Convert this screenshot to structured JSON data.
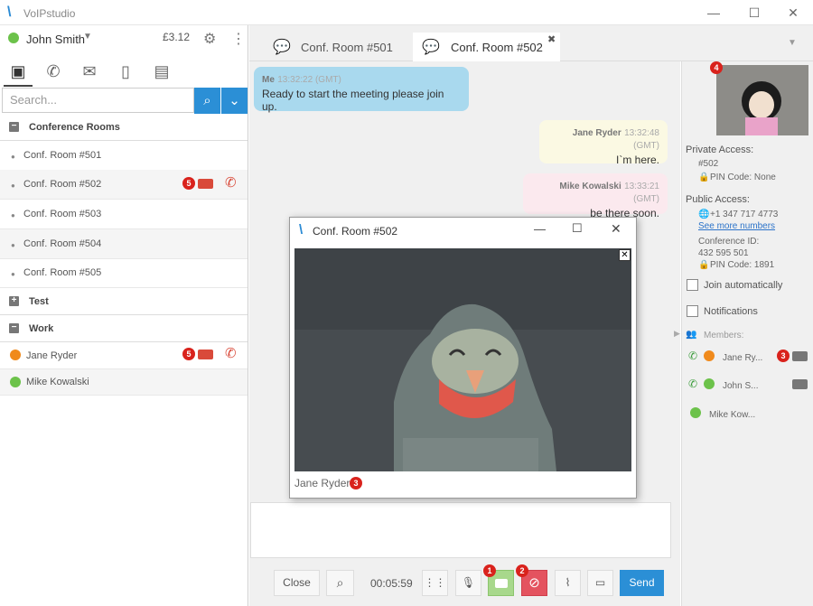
{
  "app": {
    "title": "VoIPstudio"
  },
  "user": {
    "name": "John Smith",
    "balance": "£3.12"
  },
  "search": {
    "placeholder": "Search..."
  },
  "sidebar": {
    "groups": [
      {
        "label": "Conference Rooms"
      },
      {
        "label": "Test"
      },
      {
        "label": "Work"
      }
    ],
    "rooms": [
      {
        "label": "Conf. Room #501"
      },
      {
        "label": "Conf. Room #502"
      },
      {
        "label": "Conf. Room #503"
      },
      {
        "label": "Conf. Room #504"
      },
      {
        "label": "Conf. Room #505"
      }
    ],
    "contacts": [
      {
        "label": "Jane Ryder"
      },
      {
        "label": "Mike Kowalski"
      }
    ]
  },
  "tabs": [
    {
      "label": "Conf. Room #501"
    },
    {
      "label": "Conf. Room #502"
    }
  ],
  "messages": [
    {
      "who": "Me",
      "time": "13:32:22 (GMT)",
      "text": "Ready to start the meeting please join up."
    },
    {
      "who": "Jane Ryder",
      "time": "13:32:48 (GMT)",
      "text": "I`m here."
    },
    {
      "who": "Mike Kowalski",
      "time": "13:33:21 (GMT)",
      "text": "be there soon."
    }
  ],
  "video_window": {
    "title": "Conf. Room #502",
    "caption": "Jane Ryder"
  },
  "toolbar": {
    "close_label": "Close",
    "timer": "00:05:59",
    "send_label": "Send"
  },
  "badges": {
    "b1": "1",
    "b2": "2",
    "b3": "3",
    "b4": "4",
    "b5": "5"
  },
  "details": {
    "private_label": "Private Access:",
    "private_id": "#502",
    "private_pin": "PIN Code: None",
    "public_label": "Public Access:",
    "public_phone": "+1 347 717 4773",
    "more_numbers": "See more numbers",
    "conf_id_label": "Conference ID:",
    "conf_id": "432 595 501",
    "public_pin": "PIN Code: 1891",
    "join_auto": "Join automatically",
    "notifications": "Notifications",
    "members_label": "Members:",
    "members": [
      {
        "name": "Jane Ry..."
      },
      {
        "name": "John S..."
      },
      {
        "name": "Mike Kow..."
      }
    ]
  },
  "colors": {
    "accent": "#2b8fd6",
    "red": "#d94a3a",
    "green": "#6cc24a",
    "orange": "#f08a1c"
  }
}
